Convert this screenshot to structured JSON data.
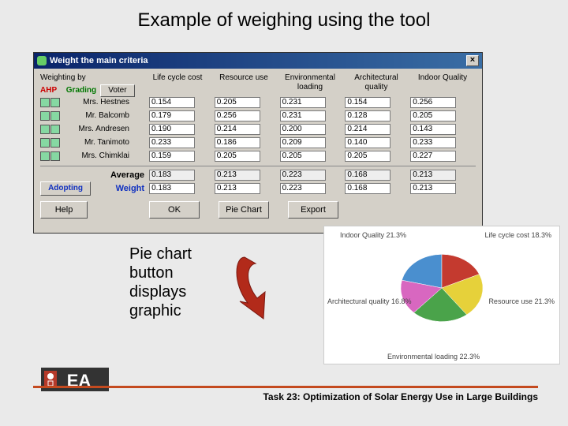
{
  "slide": {
    "title": "Example of weighing using the tool"
  },
  "window": {
    "title": "Weight the main criteria",
    "left_labels": {
      "weighting_by": "Weighting by",
      "ahp": "AHP",
      "grading": "Grading",
      "voter_btn": "Voter"
    },
    "columns": [
      "Life cycle cost",
      "Resource use",
      "Environmental loading",
      "Architectural quality",
      "Indoor Quality"
    ],
    "rows": [
      {
        "name": "Mrs. Hestnes",
        "values": [
          "0.154",
          "0.205",
          "0.231",
          "0.154",
          "0.256"
        ]
      },
      {
        "name": "Mr. Balcomb",
        "values": [
          "0.179",
          "0.256",
          "0.231",
          "0.128",
          "0.205"
        ]
      },
      {
        "name": "Mrs. Andresen",
        "values": [
          "0.190",
          "0.214",
          "0.200",
          "0.214",
          "0.143"
        ]
      },
      {
        "name": "Mr. Tanimoto",
        "values": [
          "0.233",
          "0.186",
          "0.209",
          "0.140",
          "0.233"
        ]
      },
      {
        "name": "Mrs. Chimklai",
        "values": [
          "0.159",
          "0.205",
          "0.205",
          "0.205",
          "0.227"
        ]
      }
    ],
    "average_label": "Average",
    "average": [
      "0.183",
      "0.213",
      "0.223",
      "0.168",
      "0.213"
    ],
    "weight_label": "Weight",
    "weight": [
      "0.183",
      "0.213",
      "0.223",
      "0.168",
      "0.213"
    ],
    "buttons": {
      "adopting": "Adopting",
      "help": "Help",
      "ok": "OK",
      "pie": "Pie Chart",
      "export": "Export"
    }
  },
  "callout": {
    "line1": "Pie chart",
    "line2": "button",
    "line3": "displays",
    "line4": "graphic"
  },
  "footer": {
    "task": "Task 23: Optimization of Solar Energy Use in Large Buildings"
  },
  "chart_data": {
    "type": "pie",
    "title": "",
    "series": [
      {
        "name": "Indoor Quality",
        "value": 21.3,
        "label": "Indoor Quality 21.3%",
        "color": "#4a8fcf"
      },
      {
        "name": "Life cycle cost",
        "value": 18.3,
        "label": "Life cycle cost 18.3%",
        "color": "#c43a2f"
      },
      {
        "name": "Resource use",
        "value": 21.3,
        "label": "Resource use 21.3%",
        "color": "#e6d13a"
      },
      {
        "name": "Environmental loading",
        "value": 22.3,
        "label": "Environmental loading 22.3%",
        "color": "#4aa34a"
      },
      {
        "name": "Architectural quality",
        "value": 16.8,
        "label": "Architectural quality 16.8%",
        "color": "#d867c0"
      }
    ]
  }
}
